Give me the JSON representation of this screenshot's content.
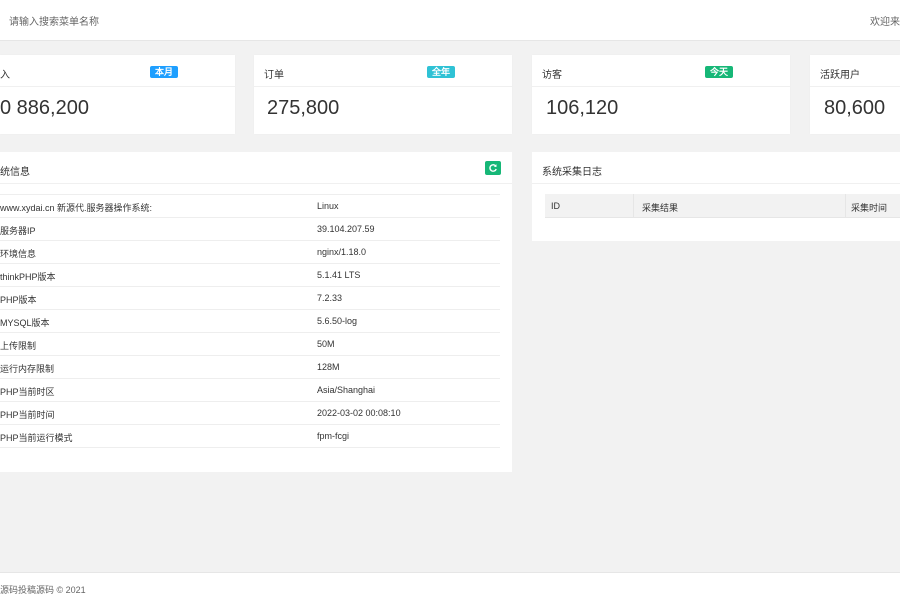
{
  "header": {
    "search_placeholder": "请输入搜索菜单名称",
    "welcome_text": "欢迎来到"
  },
  "stats": [
    {
      "title": "入",
      "badge": "本月",
      "badge_color": "#1e9fff",
      "value": "0 886,200"
    },
    {
      "title": "订单",
      "badge": "全年",
      "badge_color": "#2fc2d5",
      "value": "275,800"
    },
    {
      "title": "访客",
      "badge": "今天",
      "badge_color": "#16b777",
      "value": "106,120"
    },
    {
      "title": "活跃用户",
      "badge": "",
      "badge_color": "",
      "value": "80,600"
    }
  ],
  "system_info": {
    "title": "统信息",
    "refresh_icon": "refresh-icon",
    "rows": [
      {
        "key": "www.xydai.cn 新源代.服务器操作系统:",
        "value": "Linux"
      },
      {
        "key": "服务器IP",
        "value": "39.104.207.59"
      },
      {
        "key": "环境信息",
        "value": "nginx/1.18.0"
      },
      {
        "key": "thinkPHP版本",
        "value": "5.1.41 LTS"
      },
      {
        "key": "PHP版本",
        "value": "7.2.33"
      },
      {
        "key": "MYSQL版本",
        "value": "5.6.50-log"
      },
      {
        "key": "上传限制",
        "value": "50M"
      },
      {
        "key": "运行内存限制",
        "value": "128M"
      },
      {
        "key": "PHP当前时区",
        "value": "Asia/Shanghai"
      },
      {
        "key": "PHP当前时间",
        "value": "2022-03-02 00:08:10"
      },
      {
        "key": "PHP当前运行模式",
        "value": "fpm-fcgi"
      }
    ]
  },
  "collect_log": {
    "title": "系统采集日志",
    "columns": [
      "ID",
      "采集结果",
      "采集时间"
    ]
  },
  "footer": {
    "copyright": "源码投稿源码 © 2021"
  },
  "colors": {
    "badge_month": "#1e9fff",
    "badge_year": "#2fc2d5",
    "badge_today": "#16b777",
    "refresh": "#16b777"
  }
}
